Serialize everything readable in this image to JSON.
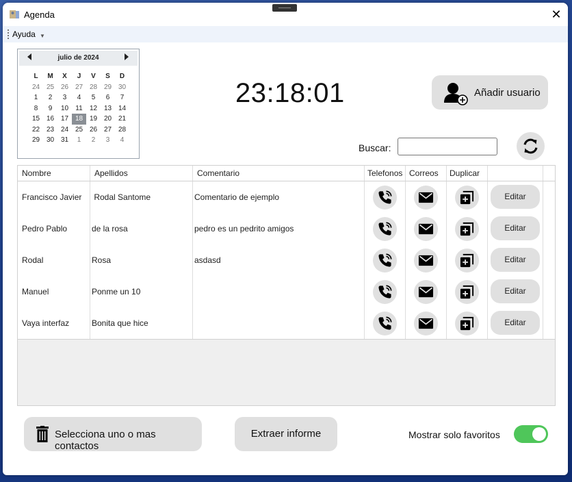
{
  "window": {
    "title": "Agenda"
  },
  "menu": {
    "items": [
      {
        "label": "Ayuda"
      }
    ]
  },
  "calendar": {
    "month_label": "julio de 2024",
    "weekdays": [
      "L",
      "M",
      "X",
      "J",
      "V",
      "S",
      "D"
    ],
    "weeks": [
      [
        "24",
        "25",
        "26",
        "27",
        "28",
        "29",
        "30"
      ],
      [
        "1",
        "2",
        "3",
        "4",
        "5",
        "6",
        "7"
      ],
      [
        "8",
        "9",
        "10",
        "11",
        "12",
        "13",
        "14"
      ],
      [
        "15",
        "16",
        "17",
        "18",
        "19",
        "20",
        "21"
      ],
      [
        "22",
        "23",
        "24",
        "25",
        "26",
        "27",
        "28"
      ],
      [
        "29",
        "30",
        "31",
        "1",
        "2",
        "3",
        "4"
      ]
    ],
    "selected_day": "18"
  },
  "clock": {
    "time": "23:18:01"
  },
  "add_user": {
    "label": "Añadir usuario"
  },
  "search": {
    "label": "Buscar:",
    "value": ""
  },
  "table": {
    "columns": [
      "Nombre",
      "Apellidos",
      "Comentario",
      "Telefonos",
      "Correos",
      "Duplicar"
    ],
    "edit_label": "Editar",
    "rows": [
      {
        "nombre": "Francisco Javier",
        "apellidos": " Rodal Santome",
        "comentario": "Comentario de ejemplo"
      },
      {
        "nombre": "Pedro Pablo",
        "apellidos": "de la rosa",
        "comentario": "pedro es un pedrito amigos"
      },
      {
        "nombre": "Rodal",
        "apellidos": "Rosa",
        "comentario": "asdasd"
      },
      {
        "nombre": "Manuel",
        "apellidos": "Ponme un 10",
        "comentario": ""
      },
      {
        "nombre": "Vaya interfaz",
        "apellidos": "Bonita que hice",
        "comentario": ""
      }
    ]
  },
  "footer": {
    "delete_label": "Selecciona uno o mas contactos",
    "report_label": "Extraer informe",
    "favorites_label": "Mostrar solo favoritos",
    "favorites_on": true
  },
  "colors": {
    "toggle_on": "#4fc65a",
    "button_bg": "#e0e0e0",
    "grid_bg": "#efefef"
  },
  "icons": [
    "app-icon",
    "close-icon",
    "calendar-prev-icon",
    "calendar-next-icon",
    "add-user-icon",
    "refresh-icon",
    "phone-icon",
    "mail-icon",
    "duplicate-icon",
    "trash-icon"
  ]
}
